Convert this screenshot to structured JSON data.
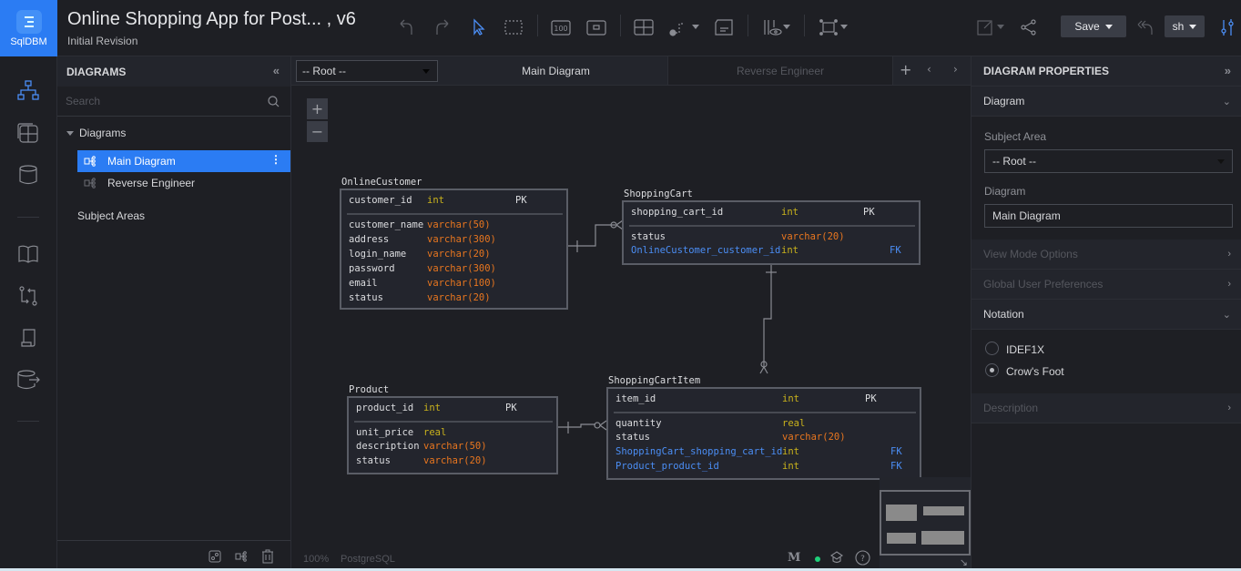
{
  "app": {
    "logo_label": "SqlDBM",
    "title": "Online Shopping App for Post...  , v6",
    "subtitle": "Initial Revision"
  },
  "toolbar": {
    "icons": [
      "undo-icon",
      "redo-icon",
      "pointer-icon",
      "select-area-icon",
      "fit-100-icon",
      "frame-icon",
      "table-grid-icon",
      "relationship-icon",
      "note-icon",
      "view-mode-icon",
      "fit-screen-icon"
    ],
    "fit_label": "100",
    "save_label": "Save",
    "user_label": "sh"
  },
  "rail": {
    "items": [
      "diagram-icon",
      "tables-icon",
      "database-icon",
      "book-icon",
      "compare-icon",
      "document-icon",
      "export-database-icon"
    ]
  },
  "diagrams_panel": {
    "title": "DIAGRAMS",
    "search_placeholder": "Search",
    "group_label": "Diagrams",
    "items": [
      {
        "label": "Main Diagram",
        "selected": true
      },
      {
        "label": "Reverse Engineer",
        "selected": false
      }
    ],
    "subject_areas_label": "Subject Areas"
  },
  "canvas": {
    "subject_area_select": "-- Root --",
    "tabs": [
      {
        "label": "Main Diagram",
        "active": true
      },
      {
        "label": "Reverse Engineer",
        "active": false
      }
    ],
    "zoom_level": "100%",
    "db_engine": "PostgreSQL",
    "status_dot_color": "#1fcf7a",
    "tables": [
      {
        "name": "OnlineCustomer",
        "pk": [
          {
            "name": "customer_id",
            "type": "int",
            "key": "PK"
          }
        ],
        "cols": [
          {
            "name": "customer_name",
            "type": "varchar(50)"
          },
          {
            "name": "address",
            "type": "varchar(300)"
          },
          {
            "name": "login_name",
            "type": "varchar(20)"
          },
          {
            "name": "password",
            "type": "varchar(300)"
          },
          {
            "name": "email",
            "type": "varchar(100)"
          },
          {
            "name": "status",
            "type": "varchar(20)"
          }
        ]
      },
      {
        "name": "ShoppingCart",
        "pk": [
          {
            "name": "shopping_cart_id",
            "type": "int",
            "key": "PK"
          }
        ],
        "cols": [
          {
            "name": "status",
            "type": "varchar(20)"
          },
          {
            "name": "OnlineCustomer_customer_id",
            "type": "int",
            "key": "FK"
          }
        ]
      },
      {
        "name": "Product",
        "pk": [
          {
            "name": "product_id",
            "type": "int",
            "key": "PK"
          }
        ],
        "cols": [
          {
            "name": "unit_price",
            "type": "real"
          },
          {
            "name": "description",
            "type": "varchar(50)"
          },
          {
            "name": "status",
            "type": "varchar(20)"
          }
        ]
      },
      {
        "name": "ShoppingCartItem",
        "pk": [
          {
            "name": "item_id",
            "type": "int",
            "key": "PK"
          }
        ],
        "cols": [
          {
            "name": "quantity",
            "type": "real"
          },
          {
            "name": "status",
            "type": "varchar(20)"
          },
          {
            "name": "ShoppingCart_shopping_cart_id",
            "type": "int",
            "key": "FK"
          },
          {
            "name": "Product_product_id",
            "type": "int",
            "key": "FK"
          }
        ]
      }
    ]
  },
  "properties": {
    "title": "DIAGRAM PROPERTIES",
    "diagram_section": "Diagram",
    "subject_area_label": "Subject Area",
    "subject_area_value": "-- Root --",
    "diagram_label": "Diagram",
    "diagram_value": "Main Diagram",
    "view_mode_options": "View Mode Options",
    "global_user_preferences": "Global User Preferences",
    "notation_section": "Notation",
    "notation_options": [
      {
        "label": "IDEF1X",
        "checked": false
      },
      {
        "label": "Crow's Foot",
        "checked": true
      }
    ],
    "description_section": "Description"
  },
  "colors": {
    "accent": "#2b7cf3",
    "pk_type_int": "#c9b21c",
    "type_varchar": "#e8761f",
    "fk": "#4b8ef5"
  }
}
